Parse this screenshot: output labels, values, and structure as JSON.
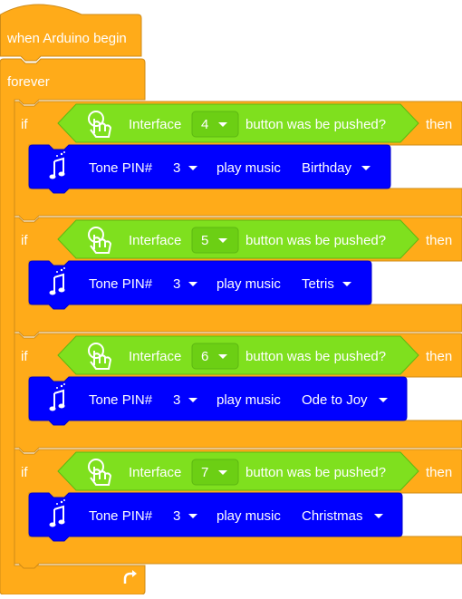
{
  "hat": {
    "label": "when Arduino begin"
  },
  "loop": {
    "label": "forever"
  },
  "ifs": [
    {
      "if_label": "if",
      "interface_label": "Interface",
      "interface_value": "4",
      "pushed_label": "button was be pushed?",
      "then_label": "then",
      "tone": {
        "label": "Tone PIN#",
        "pin": "3",
        "play_label": "play music",
        "song": "Birthday"
      }
    },
    {
      "if_label": "if",
      "interface_label": "Interface",
      "interface_value": "5",
      "pushed_label": "button was be pushed?",
      "then_label": "then",
      "tone": {
        "label": "Tone PIN#",
        "pin": "3",
        "play_label": "play music",
        "song": "Tetris"
      }
    },
    {
      "if_label": "if",
      "interface_label": "Interface",
      "interface_value": "6",
      "pushed_label": "button was be pushed?",
      "then_label": "then",
      "tone": {
        "label": "Tone PIN#",
        "pin": "3",
        "play_label": "play music",
        "song": "Ode to Joy"
      }
    },
    {
      "if_label": "if",
      "interface_label": "Interface",
      "interface_value": "7",
      "pushed_label": "button was be pushed?",
      "then_label": "then",
      "tone": {
        "label": "Tone PIN#",
        "pin": "3",
        "play_label": "play music",
        "song": "Christmas"
      }
    }
  ],
  "colors": {
    "control": "#FFAB19",
    "sensor": "#7FE01E",
    "tone": "#0000FF"
  },
  "icons": {
    "button": "touch-hand-icon",
    "tone": "music-note-icon",
    "repeat": "loop-arrow-icon"
  }
}
